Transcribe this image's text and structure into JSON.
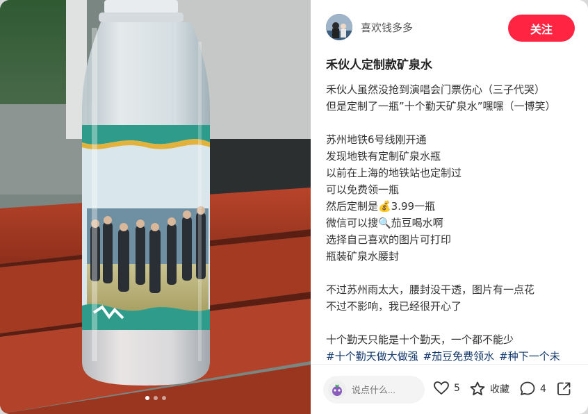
{
  "author": {
    "name": "喜欢钱多多"
  },
  "follow": {
    "label": "关注"
  },
  "post": {
    "title": "禾伙人定制款矿泉水",
    "paragraphs": [
      [
        "禾伙人虽然没抢到演唱会门票伤心（三子代哭）",
        "但是定制了一瓶”十个勤天矿泉水”嘿嘿（一博笑）"
      ],
      [
        "苏州地铁6号线刚开通",
        "发现地铁有定制矿泉水瓶",
        "以前在上海的地铁站也定制过",
        "可以免费领一瓶",
        "然后定制是💰3.99一瓶",
        "微信可以搜🔍茄豆喝水啊",
        "选择自己喜欢的图片可打印",
        "瓶装矿泉水腰封"
      ],
      [
        "不过苏州雨太大，腰封没干透，图片有一点花",
        "不过不影响，我已经很开心了"
      ],
      [
        "十个勤天只能是十个勤天，一个都不能少"
      ]
    ],
    "tags": [
      "#十个勤天做大做强",
      "#茄豆免费领水",
      "#种下一个未"
    ]
  },
  "comment": {
    "placeholder": "说点什么..."
  },
  "actions": {
    "likes": "5",
    "collect_label": "收藏",
    "comments": "4"
  },
  "carousel": {
    "total": 3,
    "current": 1
  },
  "colors": {
    "accent": "#ff2442",
    "tag": "#13386c"
  },
  "icons": [
    "heart-icon",
    "star-icon",
    "comment-icon",
    "share-icon"
  ]
}
